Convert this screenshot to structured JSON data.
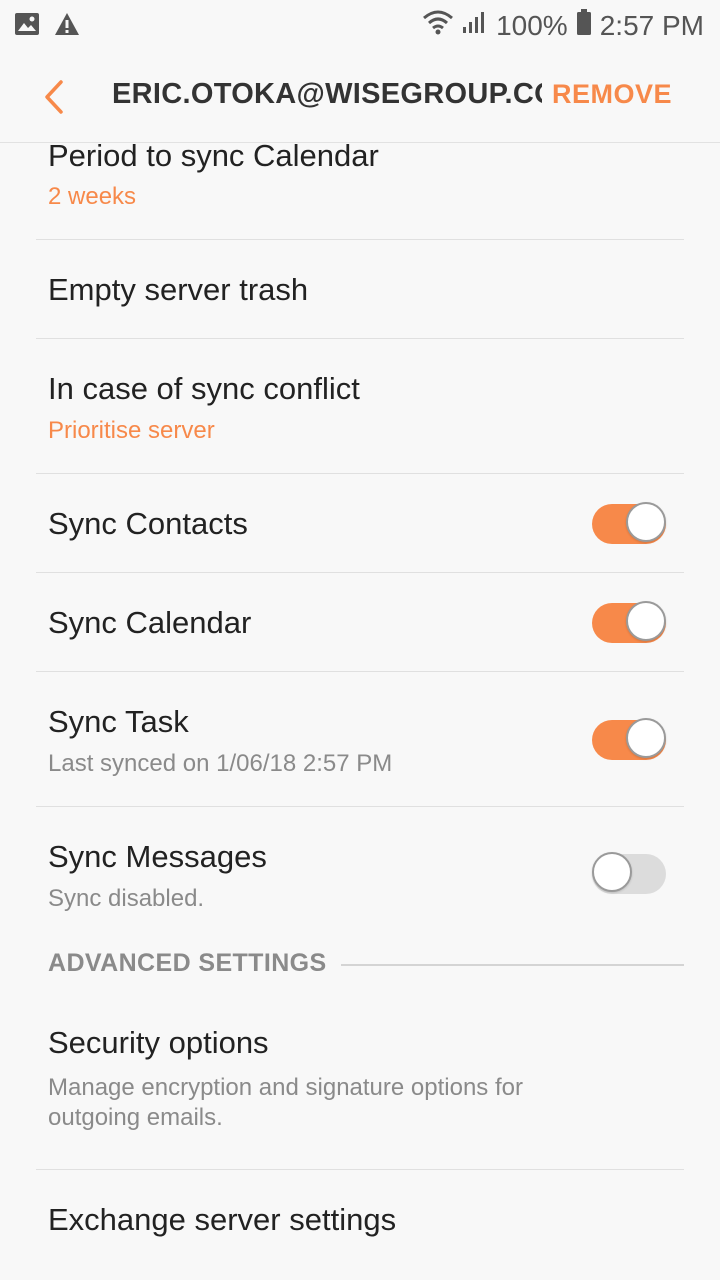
{
  "status_bar": {
    "left_icons": [
      "image-icon",
      "warning-icon"
    ],
    "battery": "100%",
    "time": "2:57 PM"
  },
  "header": {
    "back_icon": "chevron-left-icon",
    "title": "ERIC.OTOKA@WISEGROUP.CO…",
    "remove_label": "REMOVE"
  },
  "colors": {
    "accent": "#f7894a",
    "background": "#f8f8f8",
    "text_primary": "#222222",
    "text_secondary": "#8a8a8a"
  },
  "settings": {
    "period_calendar": {
      "label": "Period to sync Calendar",
      "value": "2 weeks"
    },
    "empty_trash": {
      "label": "Empty server trash"
    },
    "sync_conflict": {
      "label": "In case of sync conflict",
      "value": "Prioritise server"
    },
    "sync_contacts": {
      "label": "Sync Contacts",
      "enabled": true
    },
    "sync_calendar": {
      "label": "Sync Calendar",
      "enabled": true
    },
    "sync_task": {
      "label": "Sync Task",
      "sub": "Last synced on 1/06/18  2:57 PM",
      "enabled": true
    },
    "sync_messages": {
      "label": "Sync Messages",
      "sub": "Sync disabled.",
      "enabled": false
    }
  },
  "advanced": {
    "section_title": "ADVANCED SETTINGS",
    "security": {
      "label": "Security options",
      "sub_line1": "Manage encryption and signature options for",
      "sub_line2": "outgoing emails."
    },
    "exchange": {
      "label": "Exchange server settings"
    }
  }
}
